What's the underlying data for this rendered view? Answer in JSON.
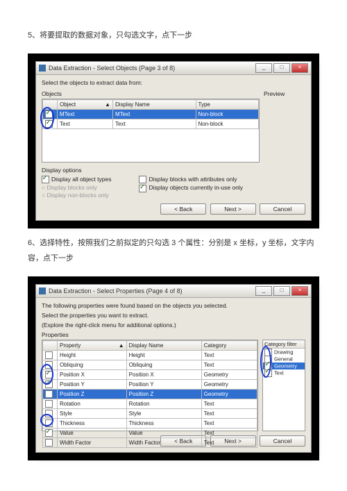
{
  "step5": {
    "text": "5、将要提取的数据对象，只勾选文字，点下一步"
  },
  "dlg1": {
    "title": "Data Extraction - Select Objects (Page 3 of 8)",
    "instr": "Select the objects to extract data from:",
    "objects_label": "Objects",
    "preview_label": "Preview",
    "cols": {
      "c1": "Object",
      "c2": "Display Name",
      "c3": "Type"
    },
    "rows": [
      {
        "checked": true,
        "object": "MText",
        "display": "MText",
        "type": "Non-block"
      },
      {
        "checked": true,
        "object": "Text",
        "display": "Text",
        "type": "Non-block"
      }
    ],
    "display_options_label": "Display options",
    "opts": {
      "all_types": "Display all object types",
      "blocks_only": "Display blocks only",
      "nonblocks_only": "Display non-blocks only",
      "blocks_attrs": "Display blocks with attributes only",
      "in_use": "Display objects currently in-use only"
    },
    "buttons": {
      "back": "< Back",
      "next": "Next >",
      "cancel": "Cancel"
    }
  },
  "step6": {
    "text": "6、选择特性，按照我们之前拟定的只勾选 3 个属性：分别是 x 坐标，y 坐标，文字内容，点下一步"
  },
  "dlg2": {
    "title": "Data Extraction - Select Properties (Page 4 of 8)",
    "instr1": "The following properties were found based on the objects you selected.",
    "instr2": "Select the properties you want to extract.",
    "instr3": "(Explore the right-click menu for additional options.)",
    "properties_label": "Properties",
    "cols": {
      "c1": "Property",
      "c2": "Display Name",
      "c3": "Category"
    },
    "rows": [
      {
        "checked": false,
        "p": "Height",
        "d": "Height",
        "c": "Text"
      },
      {
        "checked": false,
        "p": "Obliquing",
        "d": "Obliquing",
        "c": "Text"
      },
      {
        "checked": true,
        "p": "Position X",
        "d": "Position X",
        "c": "Geometry"
      },
      {
        "checked": true,
        "p": "Position Y",
        "d": "Position Y",
        "c": "Geometry"
      },
      {
        "checked": false,
        "p": "Position Z",
        "d": "Position Z",
        "c": "Geometry",
        "sel": true
      },
      {
        "checked": false,
        "p": "Rotation",
        "d": "Rotation",
        "c": "Text"
      },
      {
        "checked": false,
        "p": "Style",
        "d": "Style",
        "c": "Text"
      },
      {
        "checked": false,
        "p": "Thickness",
        "d": "Thickness",
        "c": "Text"
      },
      {
        "checked": true,
        "p": "Value",
        "d": "Value",
        "c": "Text"
      },
      {
        "checked": false,
        "p": "Width Factor",
        "d": "Width Factor",
        "c": "Text"
      }
    ],
    "cat_filter": {
      "label": "Category filter",
      "items": [
        {
          "name": "Drawing",
          "checked": false
        },
        {
          "name": "General",
          "checked": false
        },
        {
          "name": "Geometry",
          "checked": true,
          "hl": true
        },
        {
          "name": "Text",
          "checked": true
        }
      ]
    },
    "buttons": {
      "back": "< Back",
      "next": "Next >",
      "cancel": "Cancel"
    }
  }
}
